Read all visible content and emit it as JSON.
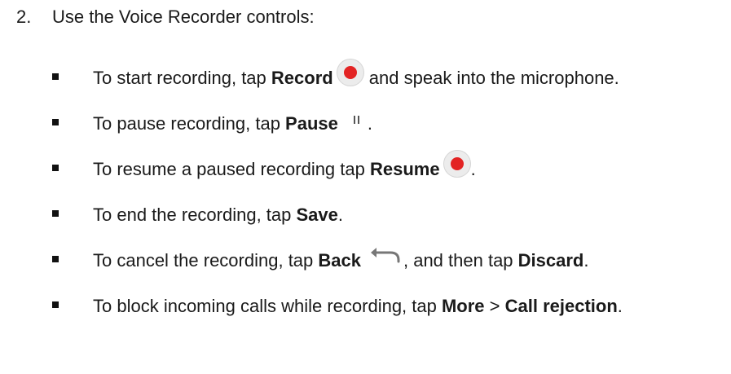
{
  "step": {
    "number": "2.",
    "text": "Use the Voice Recorder controls:"
  },
  "bullets": [
    {
      "pre": "To start recording, tap ",
      "bold": "Record",
      "icon": "record-icon",
      "post": " and speak into the microphone."
    },
    {
      "pre": "To pause recording, tap ",
      "bold": "Pause",
      "icon": "pause-icon",
      "post": "."
    },
    {
      "pre": "To resume a paused recording tap ",
      "bold": "Resume",
      "icon": "record-icon",
      "post": "."
    },
    {
      "pre": "To end the recording, tap ",
      "bold": "Save",
      "post": "."
    },
    {
      "pre": "To cancel the recording, tap ",
      "bold": "Back",
      "icon": "back-arrow-icon",
      "post": ", and then tap ",
      "bold2": "Discard",
      "post2": "."
    },
    {
      "pre": "To block incoming calls while recording, tap ",
      "bold": "More",
      "mid": " > ",
      "bold2": "Call rejection",
      "post": "."
    }
  ]
}
